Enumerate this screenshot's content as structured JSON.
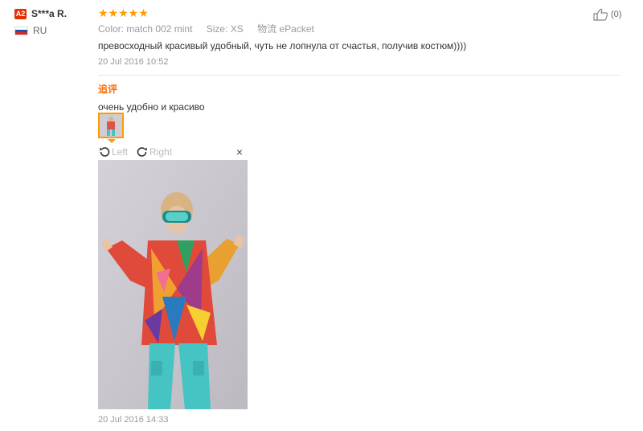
{
  "user": {
    "level": "A2",
    "name": "S***a R.",
    "country": "RU",
    "flag_colors": [
      "#ffffff",
      "#1c57a7",
      "#d52b1e"
    ]
  },
  "review": {
    "stars": "★★★★★",
    "rating": 5,
    "color_label": "Color:",
    "color_value": "match 002 mint",
    "size_label": "Size:",
    "size_value": "XS",
    "shipping_label": "物流",
    "shipping_value": "ePacket",
    "text": "превосходный красивый удобный, чуть не лопнула от счастья, получив костюм))))",
    "date": "20 Jul 2016 10:52"
  },
  "additional": {
    "label": "追评",
    "text": "очень удобно и красиво",
    "date": "20 Jul 2016 14:33"
  },
  "viewer": {
    "left_label": "Left",
    "right_label": "Right",
    "close_label": "×"
  },
  "helpful": {
    "count": "(0)"
  },
  "colors": {
    "star": "#ff9a00",
    "accent": "#ff6a00",
    "badge": "#e62e04"
  }
}
